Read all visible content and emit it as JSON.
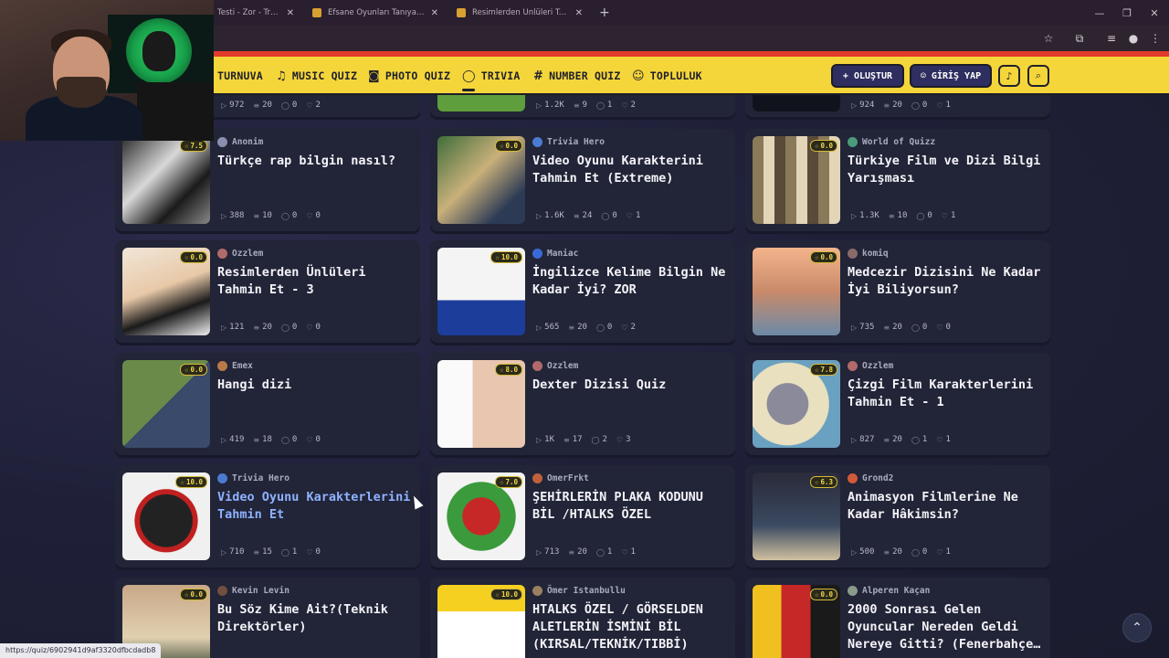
{
  "browser": {
    "tabs": [
      {
        "label": "Testi - Zor - Trivia - Qu"
      },
      {
        "label": "Efsane Oyunları Tanıyabilir Misi"
      },
      {
        "label": "Resimlerden Ünlüleri Tahmin Et"
      }
    ],
    "new_tab_icon": "plus-icon",
    "status_url": "https://quiz/6902941d9af3320dfbcdadb8"
  },
  "navbar": {
    "items": [
      {
        "label": "TURNUVA",
        "icon": "trophy-icon"
      },
      {
        "label": "MUSIC QUIZ",
        "icon": "music-note-icon"
      },
      {
        "label": "PHOTO QUIZ",
        "icon": "camera-icon"
      },
      {
        "label": "TRIVIA",
        "icon": "chat-bubble-icon"
      },
      {
        "label": "NUMBER QUIZ",
        "icon": "hash-icon"
      },
      {
        "label": "TOPLULUK",
        "icon": "users-icon"
      }
    ],
    "create_label": "OLUŞTUR",
    "login_label": "GİRİŞ YAP",
    "active_color": "#f5d63a"
  },
  "partial_row": [
    {
      "plays": "972",
      "questions": "20",
      "comments": "0",
      "likes": "2"
    },
    {
      "plays": "1.2K",
      "questions": "9",
      "comments": "1",
      "likes": "2"
    },
    {
      "plays": "924",
      "questions": "20",
      "comments": "0",
      "likes": "1"
    }
  ],
  "cards": [
    {
      "rating": "7.5",
      "author": "Anonim",
      "title": "Türkçe rap bilgin nasıl?",
      "plays": "388",
      "questions": "10",
      "comments": "0",
      "likes": "0"
    },
    {
      "rating": "0.0",
      "author": "Trivia Hero",
      "title": "Video Oyunu Karakterini Tahmin Et (Extreme)",
      "plays": "1.6K",
      "questions": "24",
      "comments": "0",
      "likes": "1"
    },
    {
      "rating": "0.0",
      "author": "World of Quizz",
      "title": "Türkiye Film ve Dizi Bilgi Yarışması",
      "plays": "1.3K",
      "questions": "10",
      "comments": "0",
      "likes": "1"
    },
    {
      "rating": "0.0",
      "author": "Ozzlem",
      "title": "Resimlerden Ünlüleri Tahmin Et - 3",
      "plays": "121",
      "questions": "20",
      "comments": "0",
      "likes": "0"
    },
    {
      "rating": "10.0",
      "author": "Maniac",
      "title": "İngilizce Kelime Bilgin Ne Kadar İyi? ZOR",
      "plays": "565",
      "questions": "20",
      "comments": "0",
      "likes": "2"
    },
    {
      "rating": "0.0",
      "author": "komiq",
      "title": "Medcezir Dizisini Ne Kadar İyi Biliyorsun?",
      "plays": "735",
      "questions": "20",
      "comments": "0",
      "likes": "0"
    },
    {
      "rating": "0.0",
      "author": "Emex",
      "title": "Hangi dizi",
      "plays": "419",
      "questions": "18",
      "comments": "0",
      "likes": "0"
    },
    {
      "rating": "8.0",
      "author": "Ozzlem",
      "title": "Dexter Dizisi Quiz",
      "plays": "1K",
      "questions": "17",
      "comments": "2",
      "likes": "3"
    },
    {
      "rating": "7.8",
      "author": "Ozzlem",
      "title": "Çizgi Film Karakterlerini Tahmin Et - 1",
      "plays": "827",
      "questions": "20",
      "comments": "1",
      "likes": "1"
    },
    {
      "rating": "10.0",
      "author": "Trivia Hero",
      "title": "Video Oyunu Karakterlerini Tahmin Et",
      "plays": "710",
      "questions": "15",
      "comments": "1",
      "likes": "0"
    },
    {
      "rating": "7.0",
      "author": "OmerFrkt",
      "title": "ŞEHİRLERİN PLAKA KODUNU BİL /HTALKS ÖZEL",
      "plays": "713",
      "questions": "20",
      "comments": "1",
      "likes": "1"
    },
    {
      "rating": "6.3",
      "author": "Grond2",
      "title": "Animasyon Filmlerine Ne Kadar Hâkimsin?",
      "plays": "500",
      "questions": "20",
      "comments": "0",
      "likes": "1"
    },
    {
      "rating": "0.0",
      "author": "Kevin Levin",
      "title": "Bu Söz Kime Ait?(Teknik Direktörler)",
      "plays": "",
      "questions": "",
      "comments": "",
      "likes": ""
    },
    {
      "rating": "10.0",
      "author": "Ömer Istanbullu",
      "title": "HTALKS ÖZEL / GÖRSELDEN ALETLERİN İSMİNİ BİL (KIRSAL/TEKNİK/TIBBİ)",
      "plays": "",
      "questions": "",
      "comments": "",
      "likes": ""
    },
    {
      "rating": "0.0",
      "author": "Alperen Kaçan",
      "title": "2000 Sonrası Gelen Oyuncular Nereden Geldi Nereye Gitti? (Fenerbahçe…",
      "plays": "",
      "questions": "",
      "comments": "",
      "likes": ""
    }
  ]
}
